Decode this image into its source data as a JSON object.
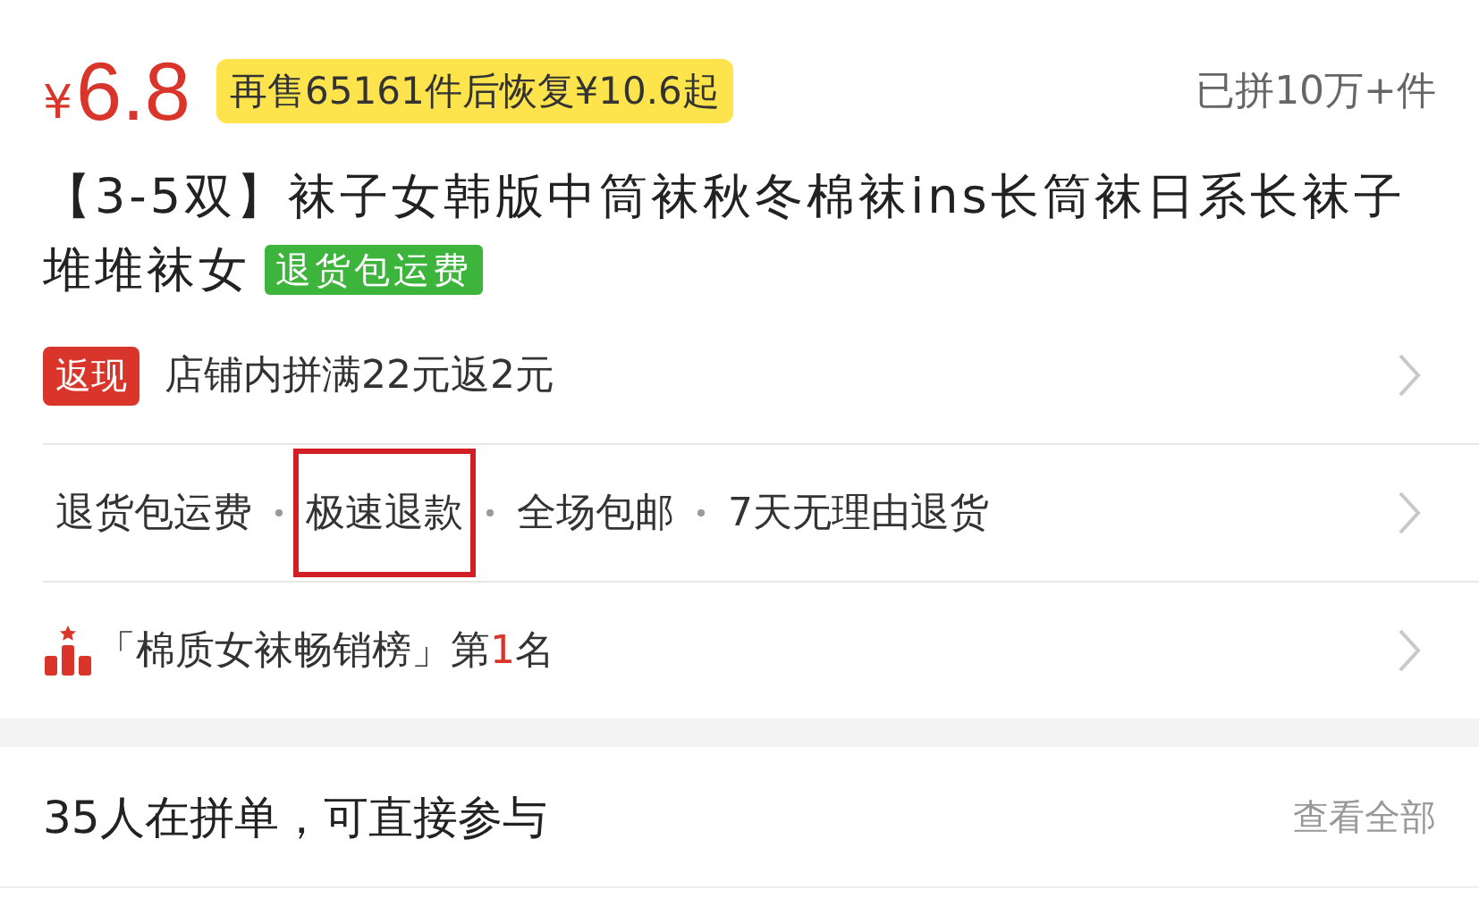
{
  "price": {
    "currency": "¥",
    "amount": "6.8",
    "promo": "再售65161件后恢复¥10.6起",
    "sold": "已拼10万+件"
  },
  "title": {
    "text": "【3-5双】袜子女韩版中筒袜秋冬棉袜ins长筒袜日系长袜子堆堆袜女",
    "tag": "退货包运费"
  },
  "rows": [
    {
      "kind": "promo",
      "badge": "返现",
      "text": "店铺内拼满22元返2元"
    },
    {
      "kind": "services",
      "items": [
        {
          "text": "退货包运费",
          "highlighted": false
        },
        {
          "text": "极速退款",
          "highlighted": true
        },
        {
          "text": "全场包邮",
          "highlighted": false
        },
        {
          "text": "7天无理由退货",
          "highlighted": false
        }
      ]
    },
    {
      "kind": "rank",
      "text": "「棉质女袜畅销榜」第**1**名"
    }
  ],
  "group": {
    "text": "35人在拼单，可直接参与",
    "link": "查看全部"
  }
}
